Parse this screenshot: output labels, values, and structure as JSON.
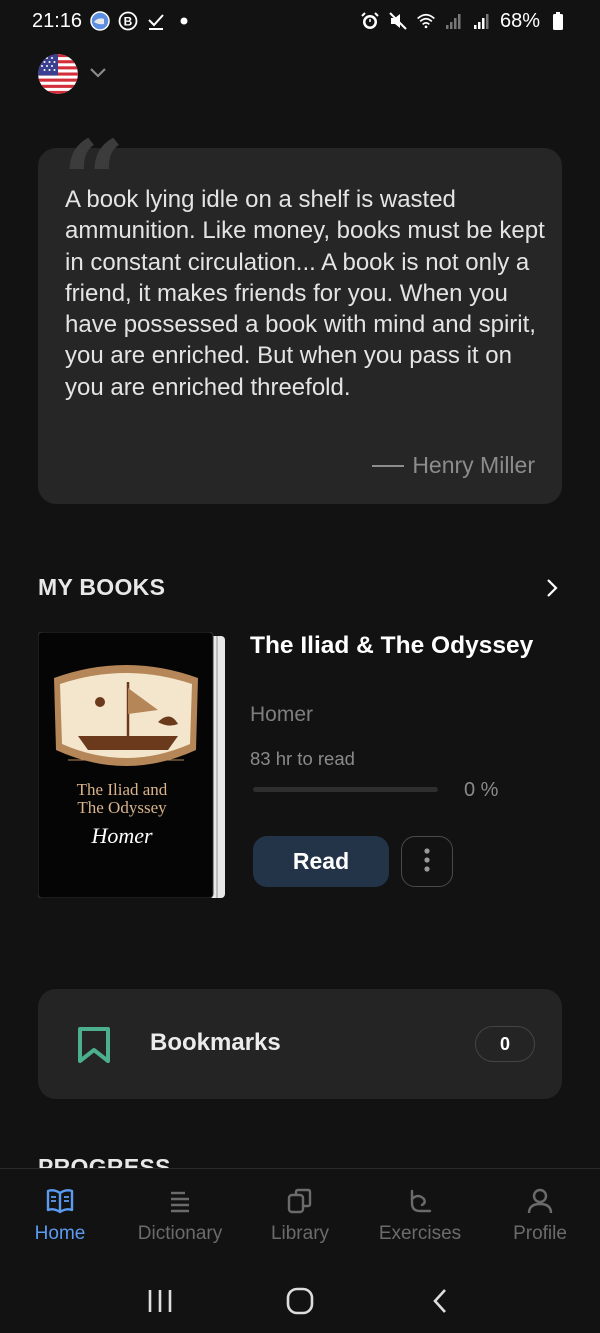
{
  "status_bar": {
    "time": "21:16",
    "battery": "68%",
    "icons_left": [
      "globe-icon",
      "b-circle-icon",
      "check-icon",
      "dot-icon"
    ],
    "icons_right": [
      "alarm-icon",
      "mute-icon",
      "wifi-icon",
      "signal-icon",
      "signal-icon",
      "battery-icon"
    ]
  },
  "language": {
    "flag": "us-flag-icon",
    "dropdown": "chevron-down-icon"
  },
  "quote": {
    "text": "A book lying idle on a shelf is wasted ammunition. Like money, books must be kept in constant circulation... A book is not only a friend, it makes friends for you. When you have possessed a book with mind and spirit, you are enriched. But when you pass it on you are enriched threefold.",
    "author": "Henry Miller"
  },
  "my_books": {
    "title": "MY BOOKS",
    "book": {
      "title": "The Iliad & The Odyssey",
      "author": "Homer",
      "cover_title_line1": "The Iliad and",
      "cover_title_line2": "The Odyssey",
      "cover_author": "Homer",
      "time_to_read": "83 hr to read",
      "progress": 0,
      "progress_label": "0 %",
      "read_label": "Read"
    }
  },
  "bookmarks": {
    "label": "Bookmarks",
    "count": "0"
  },
  "progress_section": {
    "title": "PROGRESS"
  },
  "nav": {
    "items": [
      {
        "label": "Home",
        "icon": "book-open-icon",
        "active": true
      },
      {
        "label": "Dictionary",
        "icon": "list-icon",
        "active": false
      },
      {
        "label": "Library",
        "icon": "copy-icon",
        "active": false
      },
      {
        "label": "Exercises",
        "icon": "exercise-icon",
        "active": false
      },
      {
        "label": "Profile",
        "icon": "user-icon",
        "active": false
      }
    ]
  },
  "colors": {
    "accent": "#5b9bf0",
    "bookmark": "#4caf8e",
    "card": "#262626",
    "background": "#121212"
  }
}
